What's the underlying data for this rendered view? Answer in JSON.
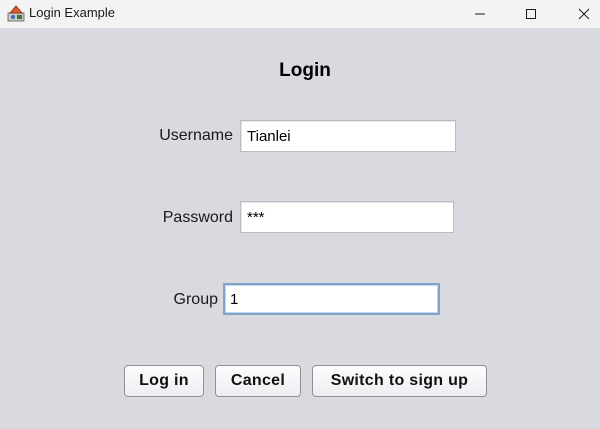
{
  "window": {
    "title": "Login Example"
  },
  "form": {
    "heading": "Login",
    "username_label": "Username",
    "username_value": "Tianlei",
    "password_label": "Password",
    "password_value": "***",
    "group_label": "Group",
    "group_value": "1"
  },
  "buttons": {
    "login": "Log in",
    "cancel": "Cancel",
    "switch": "Switch to sign up"
  },
  "colors": {
    "background": "#d8dae0",
    "titlebar": "#f3f3f3",
    "focus_border": "#7fa4cc"
  }
}
